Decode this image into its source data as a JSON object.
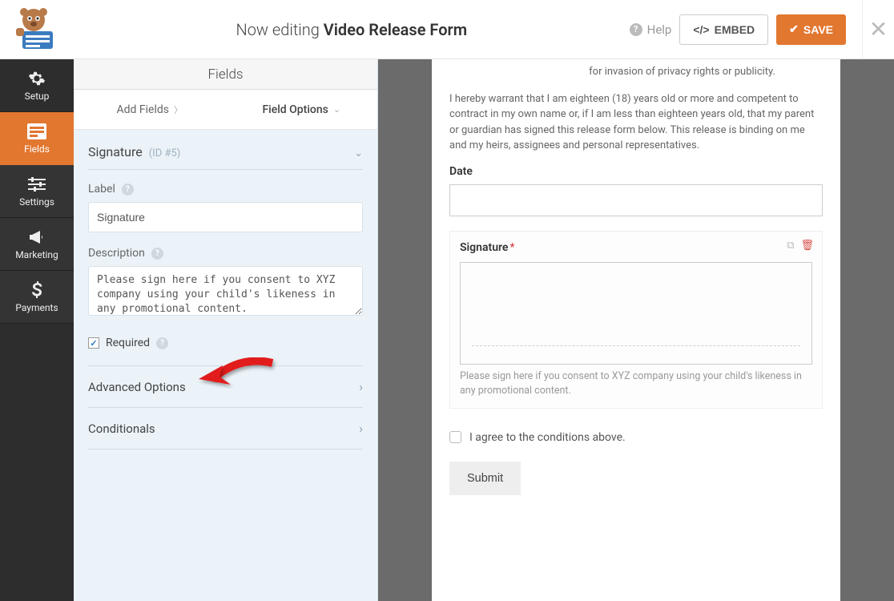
{
  "header": {
    "editing_prefix": "Now editing ",
    "form_name": "Video Release Form",
    "help": "Help",
    "embed": "EMBED",
    "save": "SAVE"
  },
  "sidebar": {
    "setup": "Setup",
    "fields": "Fields",
    "settings": "Settings",
    "marketing": "Marketing",
    "payments": "Payments"
  },
  "panel": {
    "title": "Fields",
    "tab_add": "Add Fields",
    "tab_options": "Field Options",
    "field_type": "Signature",
    "field_id": "(ID #5)",
    "label_label": "Label",
    "label_value": "Signature",
    "desc_label": "Description",
    "desc_value": "Please sign here if you consent to XYZ company using your child's likeness in any promotional content.",
    "required": "Required",
    "advanced": "Advanced Options",
    "conditionals": "Conditionals"
  },
  "preview": {
    "p1": "for invasion of privacy rights or publicity.",
    "p2": "I hereby warrant that I am eighteen (18) years old or more and competent to contract in my own name or, if I am less than eighteen years old, that my parent or guardian has signed this release form below. This release is binding on me and my heirs, assignees and personal representatives.",
    "date_label": "Date",
    "sig_label": "Signature",
    "sig_desc": "Please sign here if you consent to XYZ company using your child's likeness in any promotional content.",
    "consent": "I agree to the conditions above.",
    "submit": "Submit"
  }
}
